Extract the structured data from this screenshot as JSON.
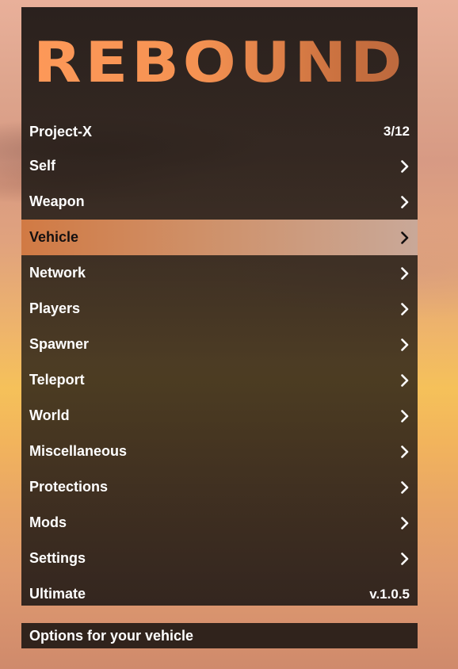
{
  "logo": {
    "text": "REBOUND"
  },
  "header": {
    "title": "Project-X",
    "position": "3/12"
  },
  "items": [
    {
      "label": "Self"
    },
    {
      "label": "Weapon"
    },
    {
      "label": "Vehicle",
      "selected": true
    },
    {
      "label": "Network"
    },
    {
      "label": "Players"
    },
    {
      "label": "Spawner"
    },
    {
      "label": "Teleport"
    },
    {
      "label": "World"
    },
    {
      "label": "Miscellaneous"
    },
    {
      "label": "Protections"
    },
    {
      "label": "Mods"
    },
    {
      "label": "Settings"
    }
  ],
  "footer": {
    "label": "Ultimate",
    "version": "v.1.0.5"
  },
  "status": {
    "description": "Options for your vehicle"
  },
  "colors": {
    "accent": "#f59252",
    "selected_start": "#d17a44",
    "selected_end": "#c9a898",
    "panel": "#1c1614"
  },
  "icons": {
    "submenu": "chevron-right-icon"
  }
}
